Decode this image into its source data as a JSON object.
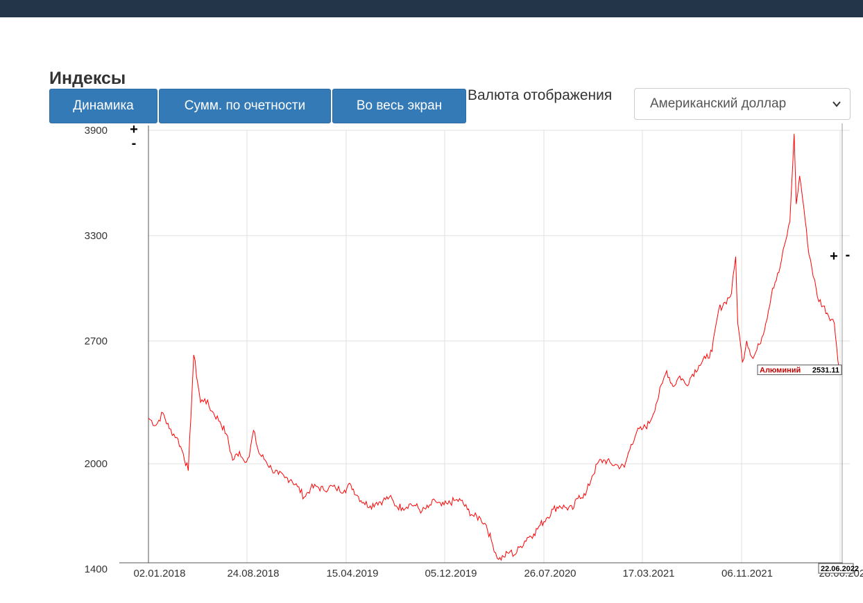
{
  "header": {
    "title": "Индексы"
  },
  "toolbar": {
    "buttons": [
      "Динамика",
      "Сумм. по очетности",
      "Во весь экран"
    ],
    "currency_label": "Валюта отображения",
    "currency_selected": "Американский доллар"
  },
  "zoom": {
    "plus": "+",
    "minus": "-"
  },
  "colors": {
    "topbar": "#233649",
    "button": "#337ab7",
    "series": "#ff0000",
    "grid": "#e0e0e0"
  },
  "chart_data": {
    "type": "line",
    "title": "",
    "xlabel": "",
    "ylabel": "",
    "ylim": [
      1400,
      3900
    ],
    "yticks": [
      1400,
      2000,
      2700,
      3300,
      3900
    ],
    "xticks": [
      "02.01.2018",
      "24.08.2018",
      "15.04.2019",
      "05.12.2019",
      "26.07.2020",
      "17.03.2021",
      "06.11.2021",
      "28.06.2022"
    ],
    "grid": true,
    "series": [
      {
        "name": "Алюминий",
        "last_value": "2531.11",
        "last_date": "22.06.2022",
        "points": [
          [
            "2018-01-02",
            2260
          ],
          [
            "2018-01-20",
            2220
          ],
          [
            "2018-02-05",
            2290
          ],
          [
            "2018-02-20",
            2200
          ],
          [
            "2018-03-10",
            2150
          ],
          [
            "2018-03-25",
            2060
          ],
          [
            "2018-04-06",
            1960
          ],
          [
            "2018-04-19",
            2620
          ],
          [
            "2018-05-05",
            2350
          ],
          [
            "2018-05-15",
            2370
          ],
          [
            "2018-06-01",
            2300
          ],
          [
            "2018-06-20",
            2240
          ],
          [
            "2018-07-05",
            2170
          ],
          [
            "2018-07-20",
            2020
          ],
          [
            "2018-08-05",
            2070
          ],
          [
            "2018-08-15",
            2020
          ],
          [
            "2018-08-28",
            2040
          ],
          [
            "2018-09-07",
            2190
          ],
          [
            "2018-09-20",
            2060
          ],
          [
            "2018-10-05",
            2020
          ],
          [
            "2018-10-20",
            1970
          ],
          [
            "2018-11-05",
            1940
          ],
          [
            "2018-11-20",
            1920
          ],
          [
            "2018-12-05",
            1910
          ],
          [
            "2018-12-20",
            1870
          ],
          [
            "2019-01-05",
            1810
          ],
          [
            "2019-01-20",
            1860
          ],
          [
            "2019-02-05",
            1870
          ],
          [
            "2019-02-20",
            1850
          ],
          [
            "2019-03-05",
            1870
          ],
          [
            "2019-03-20",
            1860
          ],
          [
            "2019-04-10",
            1850
          ],
          [
            "2019-04-25",
            1880
          ],
          [
            "2019-05-10",
            1820
          ],
          [
            "2019-05-25",
            1780
          ],
          [
            "2019-06-10",
            1760
          ],
          [
            "2019-06-25",
            1780
          ],
          [
            "2019-07-10",
            1790
          ],
          [
            "2019-07-25",
            1810
          ],
          [
            "2019-08-10",
            1760
          ],
          [
            "2019-08-25",
            1750
          ],
          [
            "2019-09-10",
            1770
          ],
          [
            "2019-09-25",
            1760
          ],
          [
            "2019-10-10",
            1730
          ],
          [
            "2019-10-25",
            1750
          ],
          [
            "2019-11-10",
            1790
          ],
          [
            "2019-11-25",
            1760
          ],
          [
            "2019-12-10",
            1770
          ],
          [
            "2019-12-25",
            1790
          ],
          [
            "2020-01-10",
            1790
          ],
          [
            "2020-01-25",
            1740
          ],
          [
            "2020-02-10",
            1700
          ],
          [
            "2020-02-25",
            1690
          ],
          [
            "2020-03-10",
            1650
          ],
          [
            "2020-03-25",
            1540
          ],
          [
            "2020-04-08",
            1455
          ],
          [
            "2020-04-20",
            1470
          ],
          [
            "2020-05-05",
            1500
          ],
          [
            "2020-05-15",
            1480
          ],
          [
            "2020-05-30",
            1530
          ],
          [
            "2020-06-15",
            1580
          ],
          [
            "2020-06-30",
            1600
          ],
          [
            "2020-07-15",
            1650
          ],
          [
            "2020-07-30",
            1690
          ],
          [
            "2020-08-15",
            1740
          ],
          [
            "2020-08-30",
            1760
          ],
          [
            "2020-09-15",
            1750
          ],
          [
            "2020-09-30",
            1740
          ],
          [
            "2020-10-15",
            1820
          ],
          [
            "2020-10-30",
            1820
          ],
          [
            "2020-11-15",
            1930
          ],
          [
            "2020-11-30",
            2010
          ],
          [
            "2020-12-15",
            2020
          ],
          [
            "2020-12-30",
            2000
          ],
          [
            "2021-01-15",
            1990
          ],
          [
            "2021-01-30",
            1980
          ],
          [
            "2021-02-15",
            2110
          ],
          [
            "2021-02-28",
            2180
          ],
          [
            "2021-03-15",
            2200
          ],
          [
            "2021-03-30",
            2230
          ],
          [
            "2021-04-15",
            2340
          ],
          [
            "2021-04-30",
            2460
          ],
          [
            "2021-05-10",
            2530
          ],
          [
            "2021-05-25",
            2440
          ],
          [
            "2021-06-10",
            2500
          ],
          [
            "2021-06-25",
            2450
          ],
          [
            "2021-07-10",
            2510
          ],
          [
            "2021-07-25",
            2560
          ],
          [
            "2021-08-10",
            2600
          ],
          [
            "2021-08-25",
            2640
          ],
          [
            "2021-09-10",
            2880
          ],
          [
            "2021-09-25",
            2920
          ],
          [
            "2021-10-10",
            2970
          ],
          [
            "2021-10-20",
            3180
          ],
          [
            "2021-10-25",
            2800
          ],
          [
            "2021-11-05",
            2580
          ],
          [
            "2021-11-15",
            2700
          ],
          [
            "2021-11-30",
            2600
          ],
          [
            "2021-12-15",
            2680
          ],
          [
            "2021-12-30",
            2800
          ],
          [
            "2022-01-15",
            3000
          ],
          [
            "2022-01-30",
            3090
          ],
          [
            "2022-02-15",
            3270
          ],
          [
            "2022-02-25",
            3380
          ],
          [
            "2022-03-07",
            3880
          ],
          [
            "2022-03-12",
            3480
          ],
          [
            "2022-03-20",
            3640
          ],
          [
            "2022-03-30",
            3460
          ],
          [
            "2022-04-08",
            3250
          ],
          [
            "2022-05-01",
            2950
          ],
          [
            "2022-06-10",
            2800
          ],
          [
            "2022-06-15",
            2680
          ],
          [
            "2022-06-22",
            2531.11
          ]
        ]
      }
    ]
  }
}
